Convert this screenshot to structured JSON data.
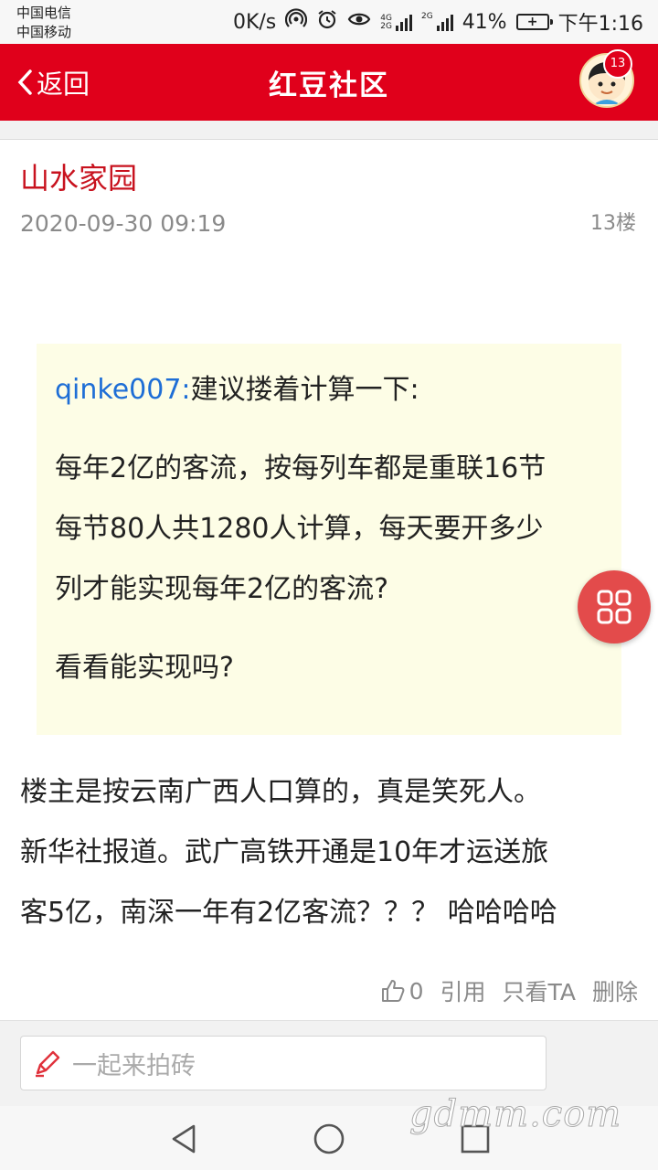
{
  "status_bar": {
    "carrier1": "中国电信",
    "carrier2": "中国移动",
    "speed": "0K/s",
    "net1": "4G",
    "net1b": "2G",
    "net2": "2G",
    "battery_pct": "41%",
    "time": "下午1:16"
  },
  "header": {
    "back_label": "返回",
    "title": "红豆社区",
    "avatar_badge": "13"
  },
  "post": {
    "author": "山水家园",
    "time": "2020-09-30 09:19",
    "floor": "13楼",
    "quote": {
      "user": "qinke007:",
      "line1": "建议搂着计算一下:",
      "para2_line1": "每年2亿的客流，按每列车都是重联16节",
      "para2_line2": "每节80人共1280人计算，每天要开多少",
      "para2_line3": "列才能实现每年2亿的客流?",
      "para3": "看看能实现吗?"
    },
    "body_lines": [
      "楼主是按云南广西人口算的，真是笑死人。",
      "新华社报道。武广高铁开通是10年才运送旅",
      "客5亿，南深一年有2亿客流？？？ 哈哈哈哈"
    ],
    "actions": {
      "likes": "0",
      "quote": "引用",
      "only_ta": "只看TA",
      "delete": "删除"
    }
  },
  "comment": {
    "placeholder": "一起来拍砖"
  },
  "watermark": "gdmm.com",
  "colors": {
    "brand_red": "#e0001b",
    "author_red": "#c8121e",
    "link_blue": "#1e6ed6",
    "quote_bg": "#fdfde6",
    "fab_red": "#e34b4b"
  }
}
